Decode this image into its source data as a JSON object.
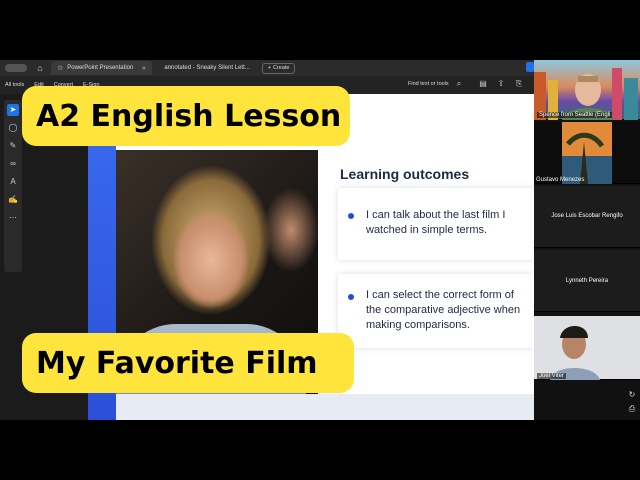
{
  "browser": {
    "tabs": [
      {
        "label": "PowerPoint Presentation",
        "active": true
      },
      {
        "label": "annotated - Sneaky Silent Lett...",
        "active": false
      }
    ],
    "create_label": "Create"
  },
  "toolbar": {
    "menu": [
      "All tools",
      "Edit",
      "Convert",
      "E-Sign"
    ],
    "find_label": "Find text or tools"
  },
  "slide": {
    "title": "Learning outcomes",
    "outcomes": [
      "I can talk about the last film I watched in simple terms.",
      "I can select the correct form of the comparative adjective when making comparisons."
    ]
  },
  "participants": [
    {
      "name": "Spence from Seattle (Engli"
    },
    {
      "name": "Gustavo Menezes"
    },
    {
      "name": "Jose Luis Escobar Rengifo"
    },
    {
      "name": "Lynneth Pereira"
    },
    {
      "name": "Joel Viter"
    }
  ],
  "overlay": {
    "top": "A2 English Lesson",
    "bottom": "My Favorite Film",
    "color": "#ffe53b"
  },
  "colors": {
    "accent_blue": "#1e73e8",
    "slide_blue": "#2b4fd8",
    "dark_text": "#1d2a44"
  },
  "icons": [
    "home-icon",
    "star-icon",
    "close-icon",
    "plus-icon",
    "search-icon",
    "cursor-icon",
    "comment-icon",
    "pen-icon",
    "lasso-icon",
    "text-box-icon",
    "stamp-icon",
    "more-icon",
    "refresh-icon",
    "document-icon"
  ]
}
